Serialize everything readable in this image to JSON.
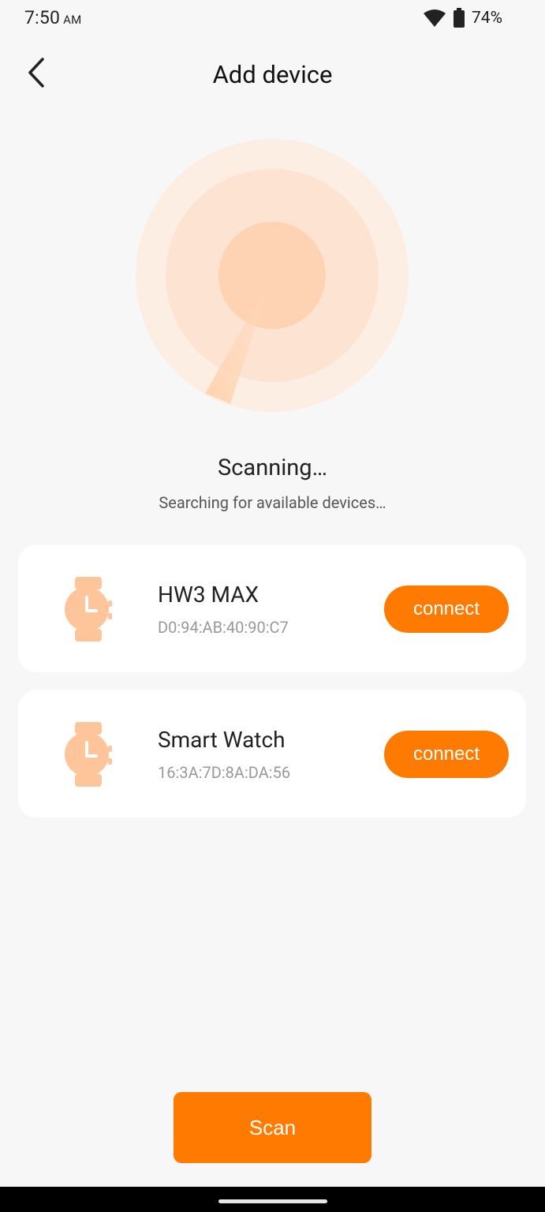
{
  "status_bar": {
    "time": "7:50",
    "ampm": "AM",
    "battery_percent": "74%",
    "icons": [
      "wifi-icon",
      "battery-icon"
    ]
  },
  "header": {
    "title": "Add device",
    "back_icon": "chevron-left-icon"
  },
  "scan": {
    "status": "Scanning…",
    "subtitle": "Searching for available devices…"
  },
  "devices": [
    {
      "name": "HW3 MAX",
      "mac": "D0:94:AB:40:90:C7",
      "button_label": "connect",
      "icon": "watch-icon"
    },
    {
      "name": "Smart Watch",
      "mac": "16:3A:7D:8A:DA:56",
      "button_label": "connect",
      "icon": "watch-icon"
    }
  ],
  "footer": {
    "scan_button_label": "Scan"
  },
  "colors": {
    "accent": "#ff7a00",
    "radar_light": "#fdeee3",
    "radar_mid": "#fde3d1",
    "watch_icon": "#ffc59a",
    "background": "#f7f7f7"
  }
}
